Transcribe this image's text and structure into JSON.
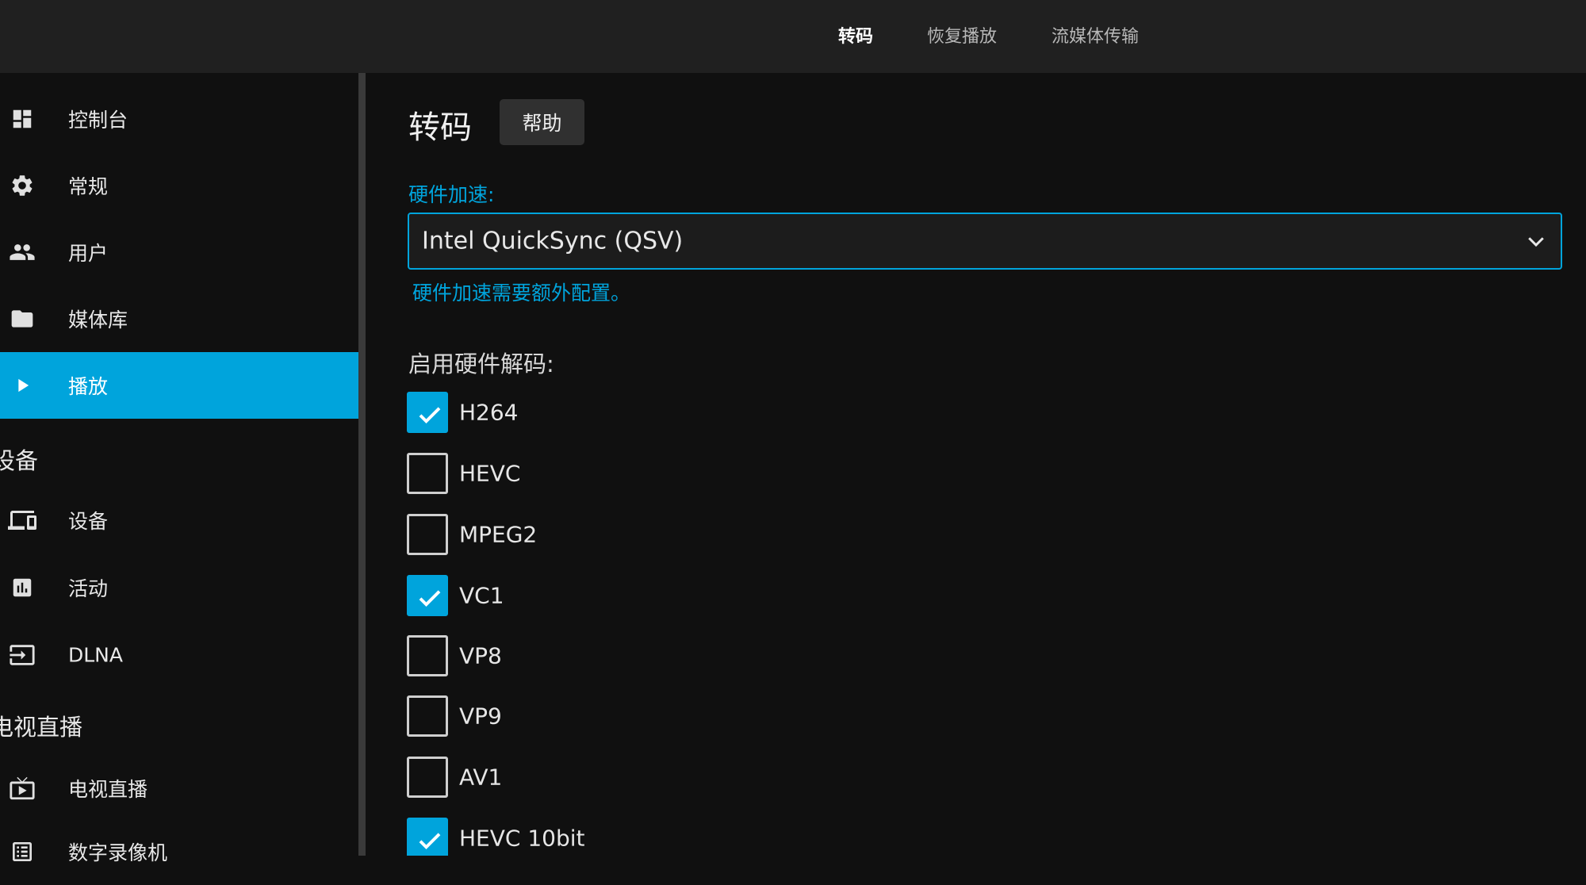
{
  "top_tabs": [
    {
      "label": "转码",
      "active": true
    },
    {
      "label": "恢复播放",
      "active": false
    },
    {
      "label": "流媒体传输",
      "active": false
    }
  ],
  "sidebar": {
    "items": [
      {
        "label": "控制台",
        "icon": "dashboard-icon"
      },
      {
        "label": "常规",
        "icon": "gear-icon"
      },
      {
        "label": "用户",
        "icon": "users-icon"
      },
      {
        "label": "媒体库",
        "icon": "folder-icon"
      },
      {
        "label": "播放",
        "icon": "play-icon",
        "active": true
      }
    ],
    "section_devices": "设备",
    "device_items": [
      {
        "label": "设备",
        "icon": "devices-icon"
      },
      {
        "label": "活动",
        "icon": "activity-chart-icon"
      },
      {
        "label": "DLNA",
        "icon": "input-icon"
      }
    ],
    "section_livetv": "电视直播",
    "livetv_items": [
      {
        "label": "电视直播",
        "icon": "tv-icon"
      },
      {
        "label": "数字录像机",
        "icon": "list-icon"
      }
    ]
  },
  "main": {
    "title": "转码",
    "help_label": "帮助",
    "hw_accel_label": "硬件加速:",
    "hw_accel_value": "Intel QuickSync (QSV)",
    "hw_accel_help": "硬件加速需要额外配置。",
    "decode_heading": "启用硬件解码:",
    "codecs": [
      {
        "label": "H264",
        "checked": true
      },
      {
        "label": "HEVC",
        "checked": false
      },
      {
        "label": "MPEG2",
        "checked": false
      },
      {
        "label": "VC1",
        "checked": true
      },
      {
        "label": "VP8",
        "checked": false
      },
      {
        "label": "VP9",
        "checked": false
      },
      {
        "label": "AV1",
        "checked": false
      },
      {
        "label": "HEVC 10bit",
        "checked": true
      }
    ]
  },
  "colors": {
    "accent": "#00a4dc",
    "background": "#101010",
    "topbar": "#202020"
  }
}
